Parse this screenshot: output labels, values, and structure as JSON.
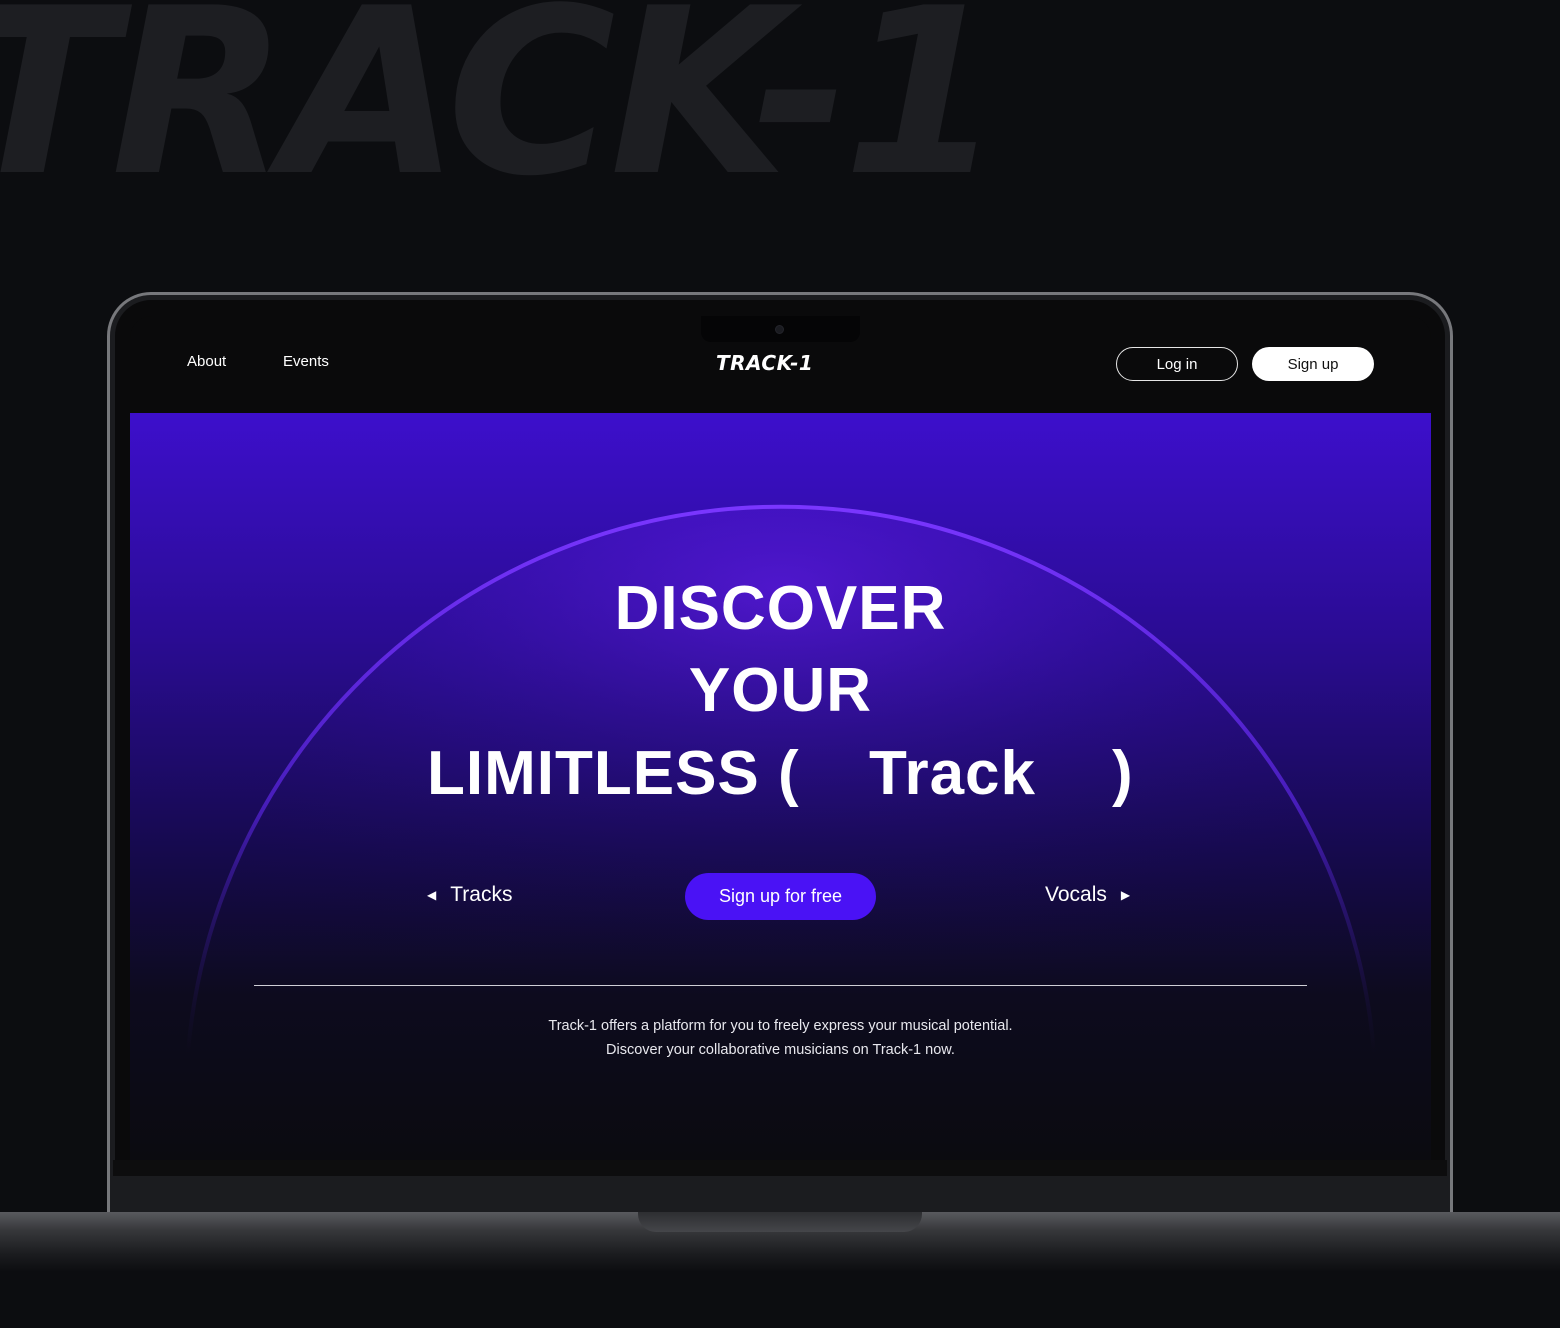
{
  "background": {
    "brand_text": "TRACK-1"
  },
  "nav": {
    "links": [
      "About",
      "Events"
    ],
    "logo": "TRACK-1",
    "login_label": "Log in",
    "signup_label": "Sign up"
  },
  "hero": {
    "line1": "DISCOVER",
    "line2": "YOUR",
    "line3_prefix": "LIMITLESS (",
    "line3_word": "Track",
    "line3_suffix": ")",
    "prev_label": "Tracks",
    "next_label": "Vocals",
    "cta_label": "Sign up for free",
    "description_line1": "Track-1 offers a platform for you to freely express your musical potential.",
    "description_line2": "Discover your collaborative musicians on Track-1 now."
  },
  "icons": {
    "prev": "left-triangle-icon",
    "next": "right-triangle-icon",
    "camera": "camera-icon"
  },
  "colors": {
    "page_bg": "#0c0d10",
    "hero_top": "#3d0fcc",
    "cta": "#4a12f5",
    "arc": "#6a2cff"
  }
}
